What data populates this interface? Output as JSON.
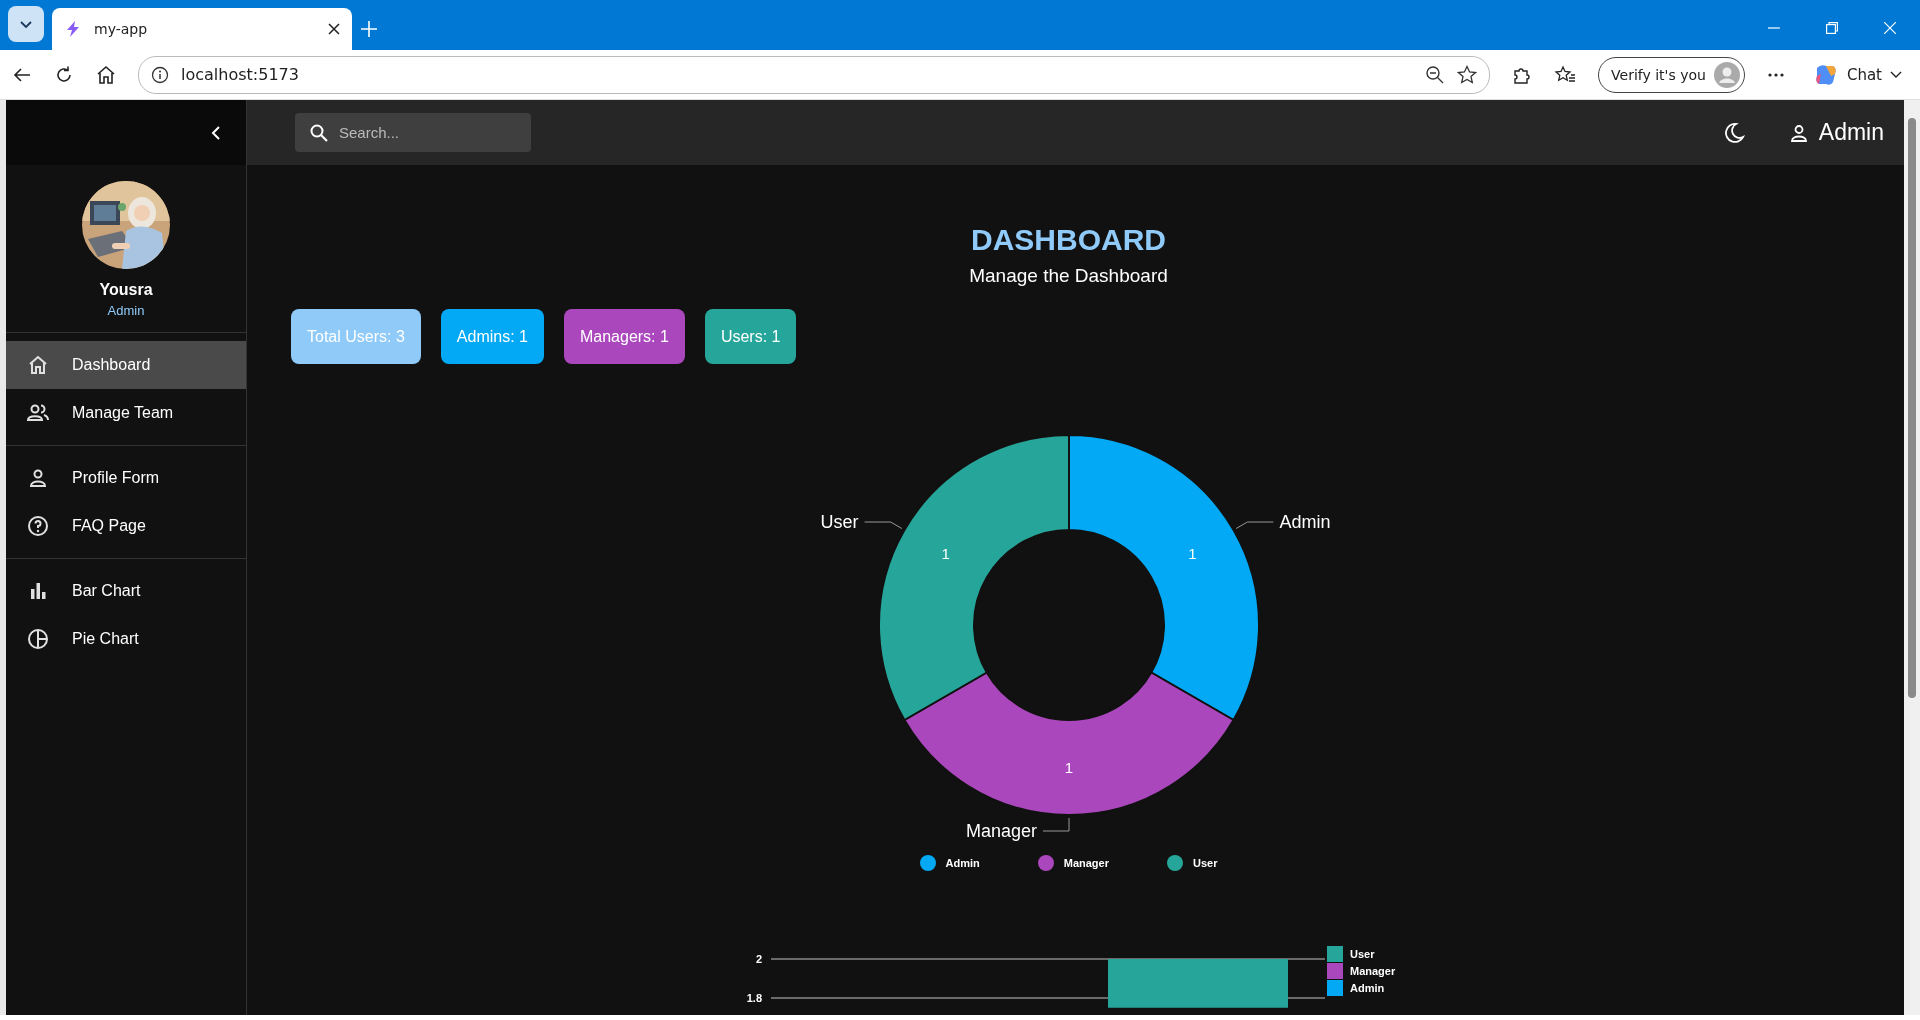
{
  "browser": {
    "tab_title": "my-app",
    "address": "localhost:5173",
    "profile_button": "Verify it's you",
    "chat_button": "Chat"
  },
  "sidebar": {
    "user": {
      "name": "Yousra",
      "role": "Admin"
    },
    "sections": [
      {
        "items": [
          {
            "label": "Dashboard",
            "kind": "home",
            "selected": true
          },
          {
            "label": "Manage Team",
            "kind": "team",
            "selected": false
          }
        ]
      },
      {
        "items": [
          {
            "label": "Profile Form",
            "kind": "person",
            "selected": false
          },
          {
            "label": "FAQ Page",
            "kind": "help",
            "selected": false
          }
        ]
      },
      {
        "items": [
          {
            "label": "Bar Chart",
            "kind": "bar",
            "selected": false
          },
          {
            "label": "Pie Chart",
            "kind": "pie",
            "selected": false
          }
        ]
      }
    ]
  },
  "topbar": {
    "search": {
      "placeholder": "Search..."
    },
    "user_label": "Admin"
  },
  "header": {
    "title": "DASHBOARD",
    "subtitle": "Manage the Dashboard"
  },
  "stats": [
    {
      "label": "Total Users: 3",
      "color": "#90caf9"
    },
    {
      "label": "Admins: 1",
      "color": "#03a9f4"
    },
    {
      "label": "Managers: 1",
      "color": "#ab47bc"
    },
    {
      "label": "Users: 1",
      "color": "#26a69a"
    }
  ],
  "pie": {
    "chart_data": {
      "type": "donut",
      "categories": [
        "Admin",
        "Manager",
        "User"
      ],
      "values": [
        1,
        1,
        1
      ],
      "data_labels": true
    },
    "legend": [
      {
        "label": "Admin",
        "color": "#03a9f4"
      },
      {
        "label": "Manager",
        "color": "#ab47bc"
      },
      {
        "label": "User",
        "color": "#26a69a"
      }
    ]
  },
  "bar": {
    "chart_data": {
      "type": "bar",
      "ylim": [
        1.75,
        2
      ],
      "yticks": [
        2,
        1.8
      ],
      "series": [
        {
          "name": "User",
          "color": "#26a69a",
          "values": [
            2
          ]
        },
        {
          "name": "Manager",
          "color": "#ab47bc",
          "values": [
            null
          ]
        },
        {
          "name": "Admin",
          "color": "#03a9f4",
          "values": [
            null
          ]
        }
      ]
    }
  }
}
